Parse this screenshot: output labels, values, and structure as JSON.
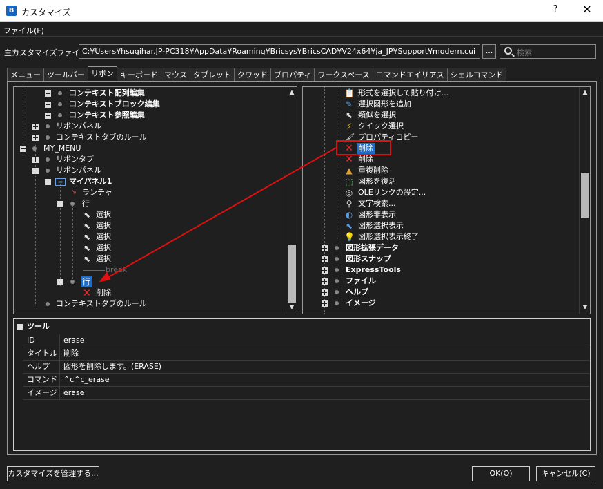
{
  "window": {
    "title": "カスタマイズ",
    "app_icon_letter": "B",
    "help_label": "?",
    "close_label": "✕"
  },
  "menu": {
    "file_label": "ファイル(F)"
  },
  "main_file": {
    "label": "主カスタマイズファイル:",
    "path": "C:¥Users¥hsugihar.JP-PC318¥AppData¥Roaming¥Bricsys¥BricsCAD¥V24x64¥ja_JP¥Support¥modern.cui",
    "browse_label": "...",
    "search_placeholder": "検索"
  },
  "tabs": [
    {
      "label": "メニュー"
    },
    {
      "label": "ツールバー"
    },
    {
      "label": "リボン"
    },
    {
      "label": "キーボード"
    },
    {
      "label": "マウス"
    },
    {
      "label": "タブレット"
    },
    {
      "label": "クワッド"
    },
    {
      "label": "プロパティ"
    },
    {
      "label": "ワークスペース"
    },
    {
      "label": "コマンドエイリアス"
    },
    {
      "label": "シェルコマンド"
    }
  ],
  "active_tab": "リボン",
  "left_tree": [
    {
      "label": "コンテキスト配列編集",
      "bold": true
    },
    {
      "label": "コンテキストブロック編集",
      "bold": true
    },
    {
      "label": "コンテキスト参照編集",
      "bold": true
    },
    {
      "label": "リボンパネル"
    },
    {
      "label": "コンテキストタブのルール"
    },
    {
      "label": "MY_MENU"
    },
    {
      "label": "リボンタブ"
    },
    {
      "label": "リボンパネル"
    },
    {
      "label": "マイパネル1",
      "bold": true
    },
    {
      "label": "ランチャ"
    },
    {
      "label": "行"
    },
    {
      "label": "選択"
    },
    {
      "label": "選択"
    },
    {
      "label": "選択"
    },
    {
      "label": "選択"
    },
    {
      "label": "選択"
    },
    {
      "label": "break"
    },
    {
      "label": "行"
    },
    {
      "label": "削除"
    },
    {
      "label": "コンテキストタブのルール"
    }
  ],
  "right_tree": [
    {
      "label": "形式を選択して貼り付け..."
    },
    {
      "label": "選択図形を追加"
    },
    {
      "label": "類似を選択"
    },
    {
      "label": "クイック選択"
    },
    {
      "label": "プロパティコピー"
    },
    {
      "label": "削除"
    },
    {
      "label": "削除"
    },
    {
      "label": "重複削除"
    },
    {
      "label": "図形を復活"
    },
    {
      "label": "OLEリンクの設定..."
    },
    {
      "label": "文字検索..."
    },
    {
      "label": "図形非表示"
    },
    {
      "label": "図形選択表示"
    },
    {
      "label": "図形選択表示終了"
    },
    {
      "label": "図形拡張データ",
      "bold": true
    },
    {
      "label": "図形スナップ",
      "bold": true
    },
    {
      "label": "ExpressTools",
      "bold": true
    },
    {
      "label": "ファイル",
      "bold": true
    },
    {
      "label": "ヘルプ",
      "bold": true
    },
    {
      "label": "イメージ",
      "bold": true
    }
  ],
  "properties": {
    "section_title": "ツール",
    "rows": [
      {
        "key": "ID",
        "value": "erase"
      },
      {
        "key": "タイトル",
        "value": "削除"
      },
      {
        "key": "ヘルプ",
        "value": "図形を削除します。(ERASE)"
      },
      {
        "key": "コマンド",
        "value": "^c^c_erase"
      },
      {
        "key": "イメージ",
        "value": "erase"
      }
    ]
  },
  "buttons": {
    "manage": "カスタマイズを管理する...",
    "ok": "OK(O)",
    "cancel": "キャンセル(C)"
  },
  "colors": {
    "selection": "#1e6cc8",
    "callout": "#e01010",
    "background": "#1f1f1f"
  }
}
